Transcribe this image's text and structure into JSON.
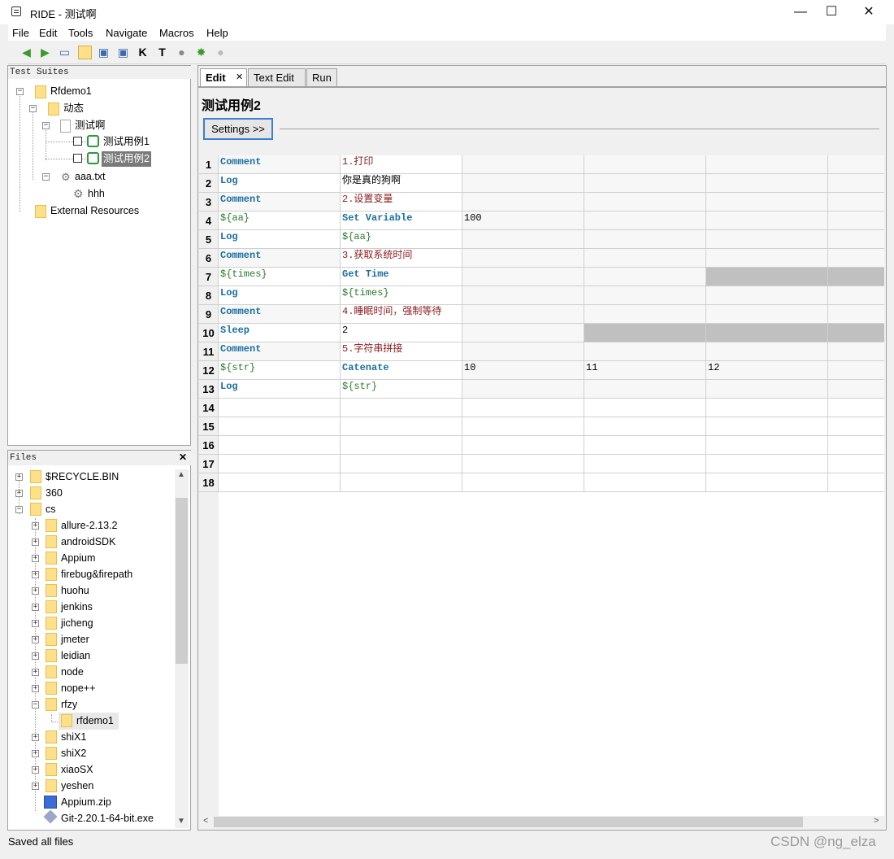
{
  "window": {
    "title": "RIDE - 测试啊",
    "minimize": "—",
    "maximize": "☐",
    "close": "✕"
  },
  "menu": [
    "File",
    "Edit",
    "Tools",
    "Navigate",
    "Macros",
    "Help"
  ],
  "toolbar_icons": [
    "back-icon",
    "forward-icon",
    "open-icon",
    "folder-icon",
    "save-icon",
    "save-all-icon",
    "keyword-search-icon",
    "test-search-icon",
    "run-icon",
    "debug-icon",
    "stop-icon"
  ],
  "suites": {
    "header": "Test Suites",
    "items": [
      {
        "label": "Rfdemo1"
      },
      {
        "label": "动态"
      },
      {
        "label": "测试啊"
      },
      {
        "label": "测试用例1"
      },
      {
        "label": "测试用例2"
      },
      {
        "label": "aaa.txt"
      },
      {
        "label": "hhh"
      },
      {
        "label": "External Resources"
      }
    ]
  },
  "files": {
    "header": "Files",
    "close": "✕",
    "items": [
      {
        "label": "$RECYCLE.BIN"
      },
      {
        "label": "360"
      },
      {
        "label": "cs"
      },
      {
        "label": "allure-2.13.2"
      },
      {
        "label": "androidSDK"
      },
      {
        "label": "Appium"
      },
      {
        "label": "firebug&firepath"
      },
      {
        "label": "huohu"
      },
      {
        "label": "jenkins"
      },
      {
        "label": "jicheng"
      },
      {
        "label": "jmeter"
      },
      {
        "label": "leidian"
      },
      {
        "label": "node"
      },
      {
        "label": "nope++"
      },
      {
        "label": "rfzy"
      },
      {
        "label": "rfdemo1"
      },
      {
        "label": "shiX1"
      },
      {
        "label": "shiX2"
      },
      {
        "label": "xiaoSX"
      },
      {
        "label": "yeshen"
      },
      {
        "label": "Appium.zip"
      },
      {
        "label": "Git-2.20.1-64-bit.exe"
      }
    ]
  },
  "tabs": [
    {
      "label": "Edit",
      "close": "✕"
    },
    {
      "label": "Text Edit"
    },
    {
      "label": "Run"
    }
  ],
  "editor": {
    "test_name": "测试用例2",
    "settings_label": "Settings >>"
  },
  "grid": {
    "row_numbers": [
      "1",
      "2",
      "3",
      "4",
      "5",
      "6",
      "7",
      "8",
      "9",
      "10",
      "11",
      "12",
      "13",
      "14",
      "15",
      "16",
      "17",
      "18"
    ],
    "rows": [
      [
        "Comment",
        "1.打印",
        "",
        "",
        "",
        ""
      ],
      [
        "Log",
        "你是真的狗啊",
        "",
        "",
        "",
        ""
      ],
      [
        "Comment",
        "2.设置变量",
        "",
        "",
        "",
        ""
      ],
      [
        "${aa}",
        "Set Variable",
        "100",
        "",
        "",
        ""
      ],
      [
        "Log",
        "${aa}",
        "",
        "",
        "",
        ""
      ],
      [
        "Comment",
        "3.获取系统时间",
        "",
        "",
        "",
        ""
      ],
      [
        "${times}",
        "Get Time",
        "",
        "",
        "",
        ""
      ],
      [
        "Log",
        "${times}",
        "",
        "",
        "",
        ""
      ],
      [
        "Comment",
        "4.睡眠时间，强制等待",
        "",
        "",
        "",
        ""
      ],
      [
        "Sleep",
        "2",
        "",
        "",
        "",
        ""
      ],
      [
        "Comment",
        "5.字符串拼接",
        "",
        "",
        "",
        ""
      ],
      [
        "${str}",
        "Catenate",
        "10",
        "11",
        "12",
        ""
      ],
      [
        "Log",
        "${str}",
        "",
        "",
        "",
        ""
      ],
      [
        "",
        "",
        "",
        "",
        "",
        ""
      ],
      [
        "",
        "",
        "",
        "",
        "",
        ""
      ],
      [
        "",
        "",
        "",
        "",
        "",
        ""
      ],
      [
        "",
        "",
        "",
        "",
        "",
        ""
      ],
      [
        "",
        "",
        "",
        "",
        "",
        ""
      ]
    ]
  },
  "status": "Saved all files",
  "watermark": "CSDN @ng_elza"
}
